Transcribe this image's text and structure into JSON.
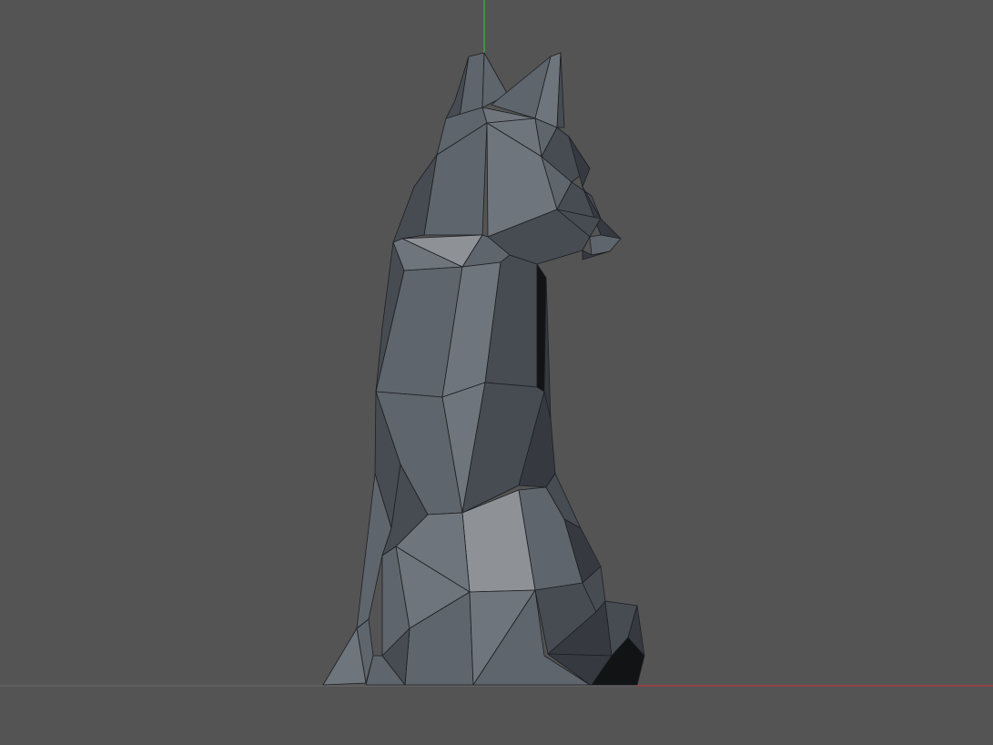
{
  "viewport": {
    "background_color": "#545454",
    "grid_line_color": "#6a6a6a",
    "x_axis_color": "#b23a3a",
    "y_axis_color": "#2fbf3f"
  },
  "model": {
    "shading": "flat low-poly",
    "edge_color": "#1c1e22",
    "palette": {
      "highlight": "#8e9297",
      "light": "#6f757c",
      "mid": "#5f656c",
      "dark": "#474c53",
      "darker": "#363a40",
      "darkest": "#111315"
    }
  }
}
